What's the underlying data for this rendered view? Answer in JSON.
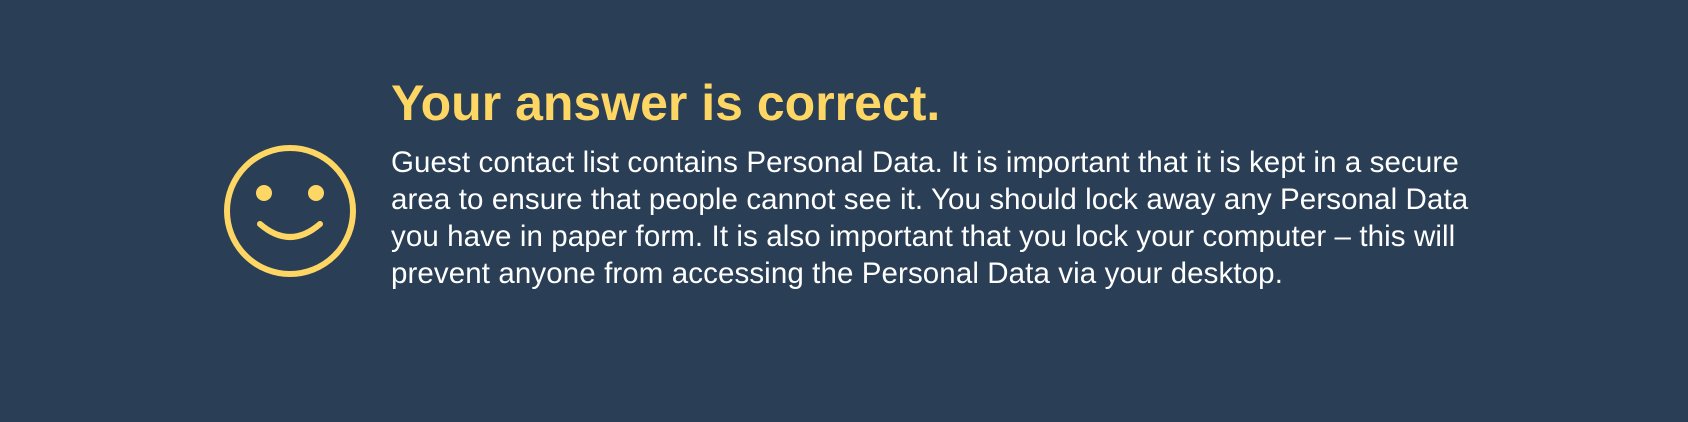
{
  "feedback": {
    "status": "correct",
    "icon": "smiley-face-icon",
    "title": "Your answer is correct.",
    "message": "Guest contact list contains Personal Data. It is important that it is kept in a secure area to ensure that people cannot see it. You should lock away any Personal Data you have in paper form. It is also important that you lock your computer – this will prevent anyone from accessing the Personal Data via your desktop."
  },
  "colors": {
    "background": "#2a3f56",
    "accent": "#fdd663",
    "text": "#ffffff"
  }
}
